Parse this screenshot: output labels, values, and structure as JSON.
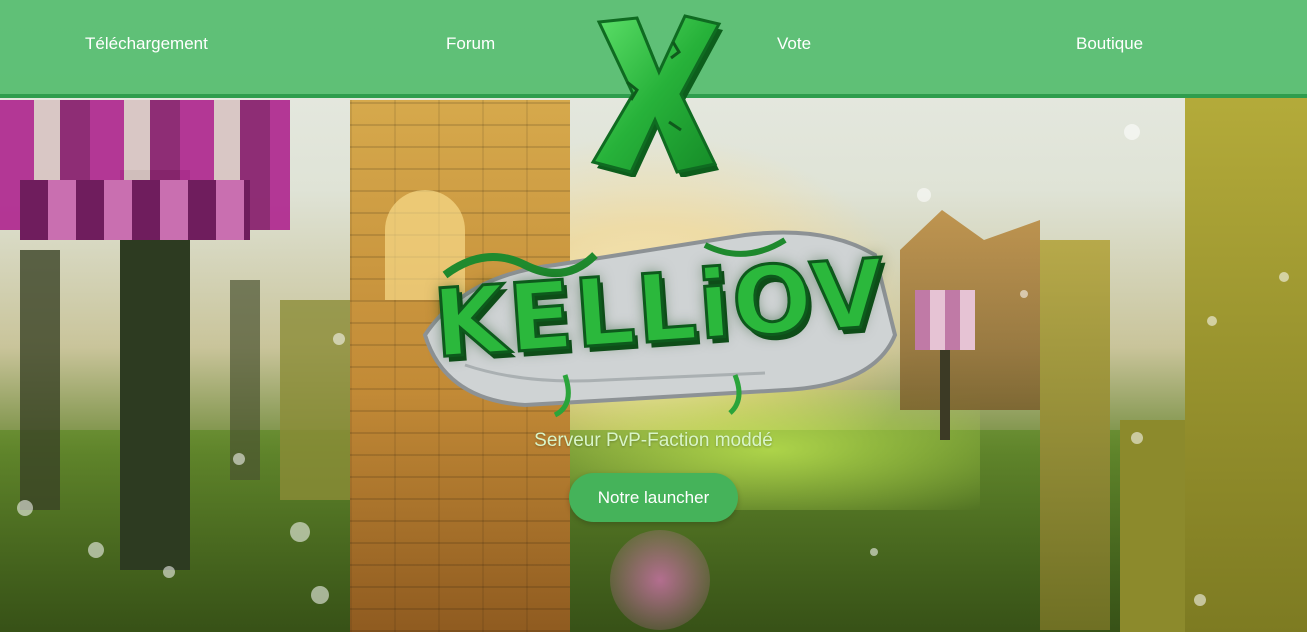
{
  "nav": {
    "items": [
      {
        "label": "Téléchargement"
      },
      {
        "label": "Forum"
      },
      {
        "label": "Vote"
      },
      {
        "label": "Boutique"
      }
    ]
  },
  "logo": {
    "letter": "X",
    "icon": "x-logo-icon"
  },
  "hero": {
    "title": "KELLiOV",
    "tagline": "Serveur PvP-Faction moddé",
    "cta_label": "Notre launcher"
  },
  "colors": {
    "nav_background": "#4cba68",
    "nav_border": "#2f9d4d",
    "button_background": "#45b35a",
    "logo_green": "#2bb83c",
    "tagline_color": "#d8f5c8"
  }
}
